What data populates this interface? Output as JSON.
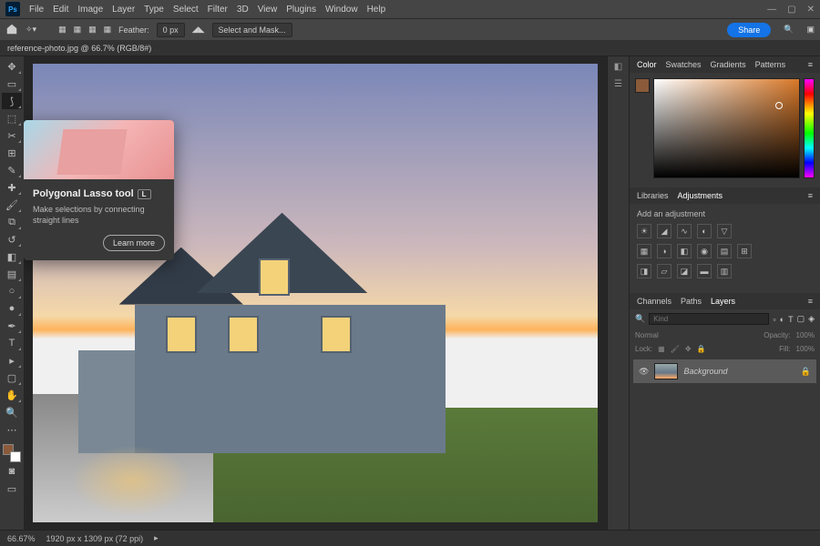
{
  "app_logo": "Ps",
  "menu": [
    "File",
    "Edit",
    "Image",
    "Layer",
    "Type",
    "Select",
    "Filter",
    "3D",
    "View",
    "Plugins",
    "Window",
    "Help"
  ],
  "options_bar": {
    "feather_label": "Feather:",
    "feather_value": "0 px",
    "select_mask": "Select and Mask...",
    "share": "Share"
  },
  "document_tab": "reference-photo.jpg @ 66.7% (RGB/8#)",
  "tooltip": {
    "title": "Polygonal Lasso tool",
    "key": "L",
    "desc": "Make selections by connecting straight lines",
    "learn": "Learn more"
  },
  "panels": {
    "color_tabs": [
      "Color",
      "Swatches",
      "Gradients",
      "Patterns"
    ],
    "lib_tabs": [
      "Libraries",
      "Adjustments"
    ],
    "adj_label": "Add an adjustment",
    "layer_tabs": [
      "Channels",
      "Paths",
      "Layers"
    ],
    "search_placeholder": "Kind",
    "blend_mode": "Normal",
    "opacity_label": "Opacity:",
    "opacity_value": "100%",
    "lock_label": "Lock:",
    "fill_label": "Fill:",
    "fill_value": "100%",
    "layer_name": "Background"
  },
  "status": {
    "zoom": "66.67%",
    "dims": "1920 px x 1309 px (72 ppi)"
  }
}
